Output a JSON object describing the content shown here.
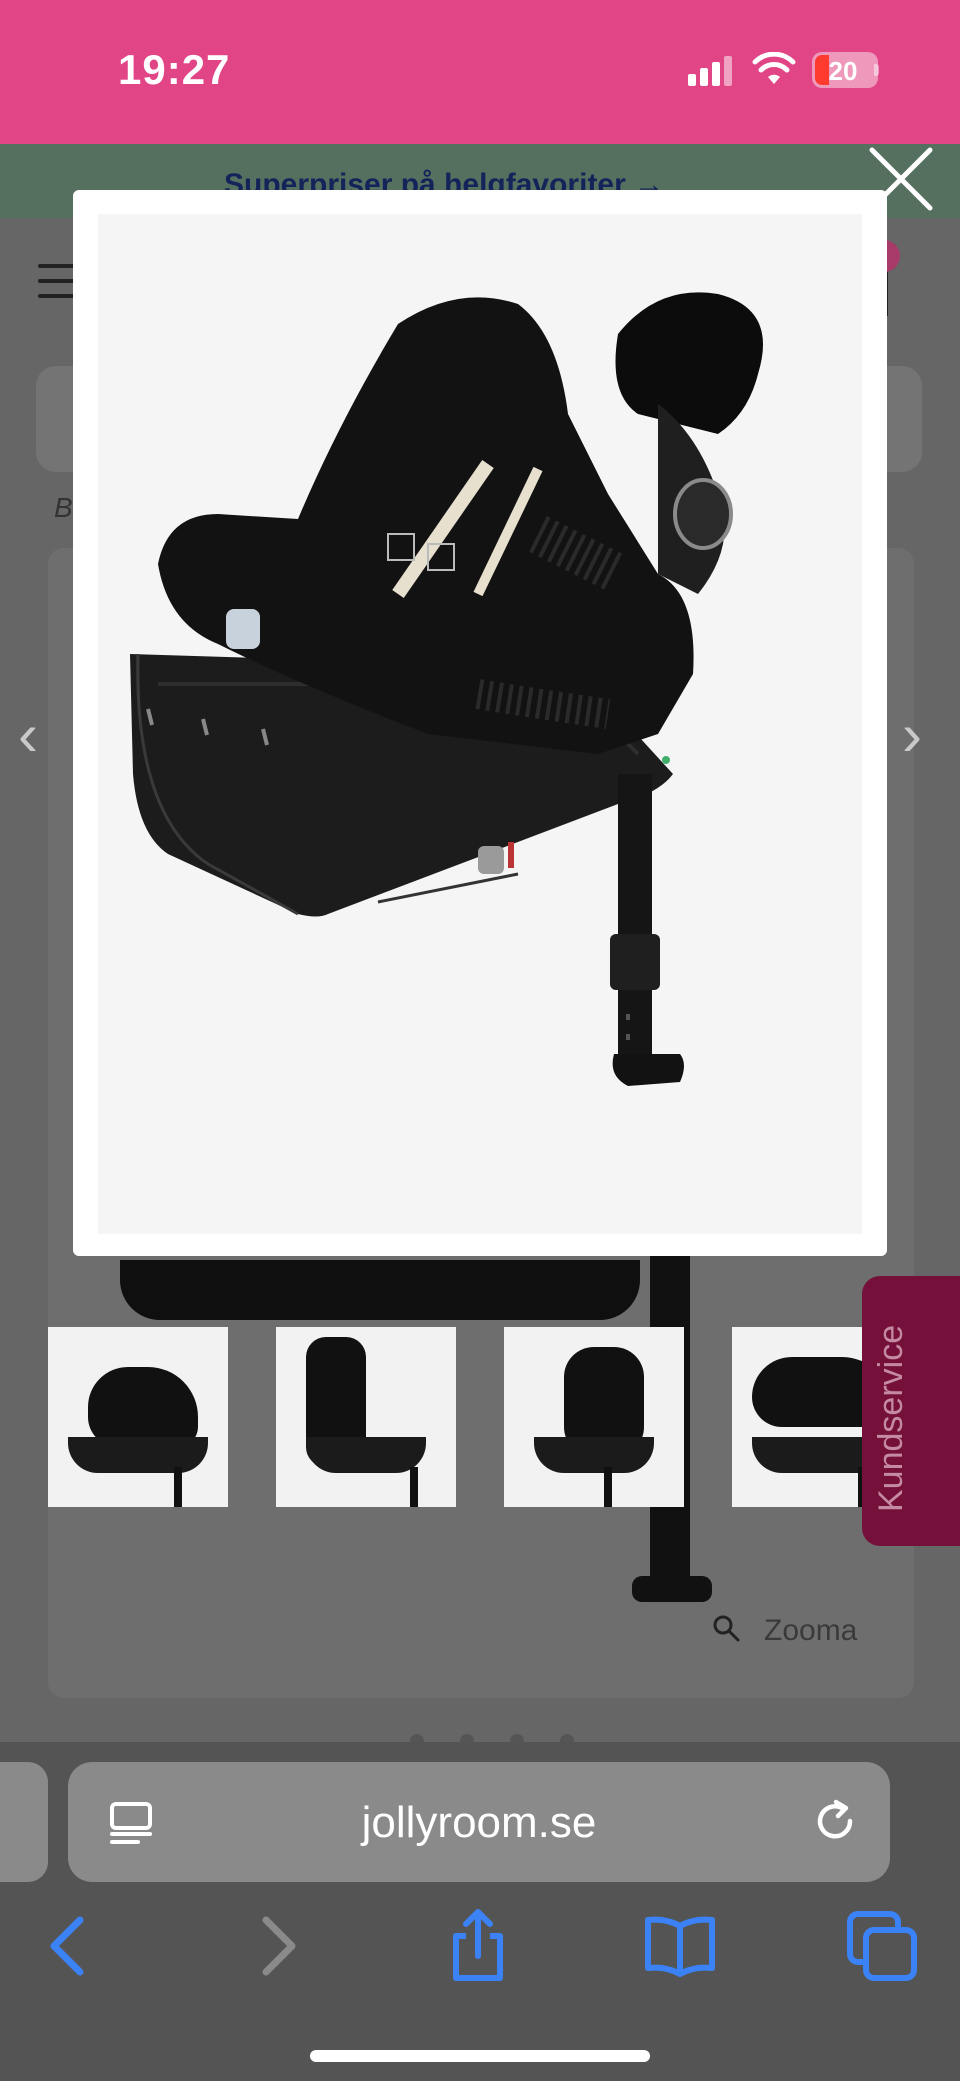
{
  "status_bar": {
    "time": "19:27",
    "battery": "20",
    "background_color": "#e14586"
  },
  "promo_banner": {
    "text": "Superpriser på helgfavoriter →"
  },
  "background_page": {
    "breadcrumb_initial": "B",
    "zoom_label": "Zooma",
    "kundservice_label": "Kundservice",
    "carousel_dot_count": 4
  },
  "modal": {
    "image_alt": "Cybex bilbarnstol",
    "close_icon": "close-icon"
  },
  "thumbnails": [
    {
      "view": "side"
    },
    {
      "view": "profile"
    },
    {
      "view": "front"
    },
    {
      "view": "rear"
    }
  ],
  "browser": {
    "url": "jollyroom.se",
    "toolbar": [
      "back-icon",
      "forward-icon",
      "share-icon",
      "bookmarks-icon",
      "tabs-icon"
    ],
    "accent_color": "#3b82f6"
  }
}
